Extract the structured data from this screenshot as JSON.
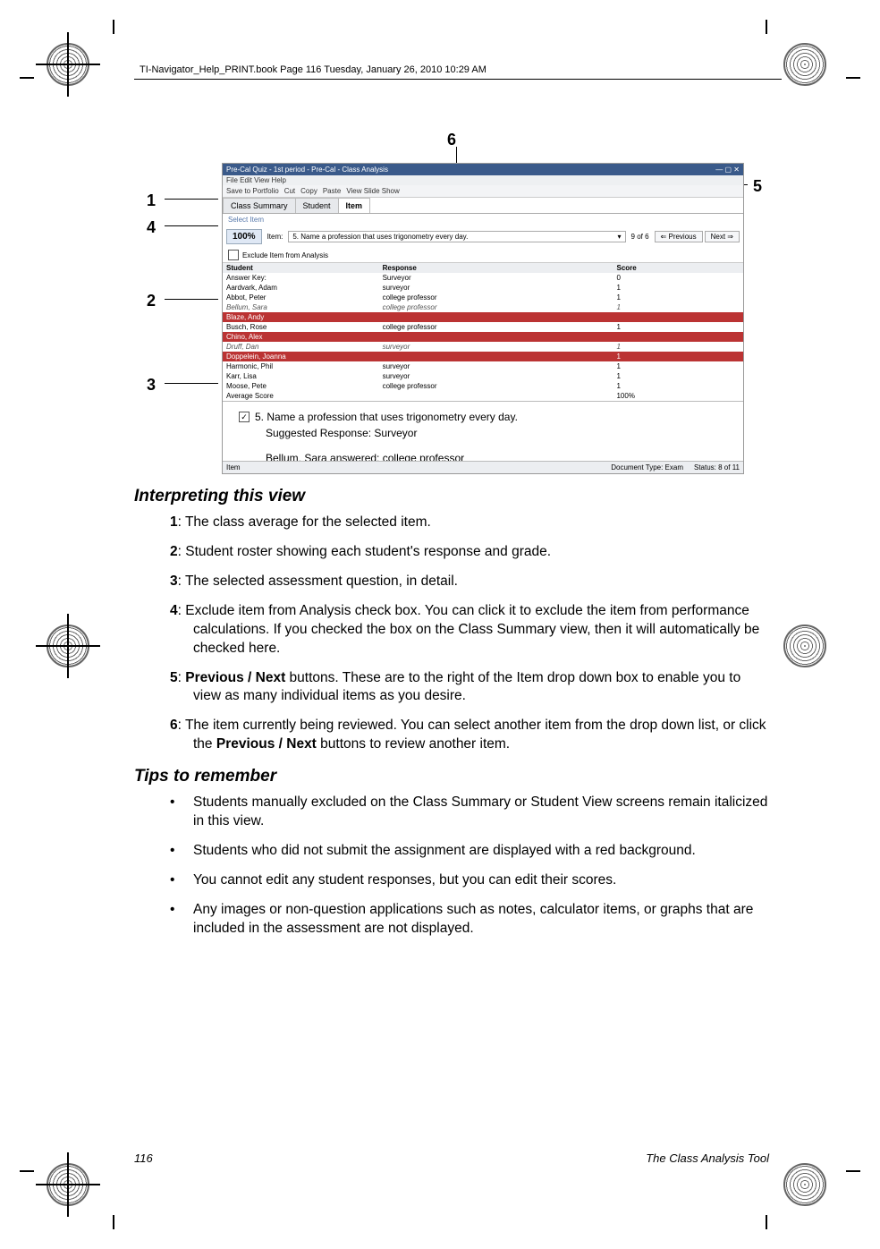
{
  "runhead": "TI-Navigator_Help_PRINT.book  Page 116  Tuesday, January 26, 2010  10:29 AM",
  "callouts": {
    "c1": "1",
    "c2": "2",
    "c3": "3",
    "c4": "4",
    "c5": "5",
    "c6": "6"
  },
  "shot": {
    "title": "Pre-Cal Quiz - 1st period - Pre-Cal - Class Analysis",
    "menus": "File    Edit    View    Help",
    "toolbar": {
      "save": "Save to Portfolio",
      "cut": "Cut",
      "copy": "Copy",
      "paste": "Paste",
      "slide": "View Slide Show"
    },
    "tabs": {
      "t1": "Class Summary",
      "t2": "Student",
      "t3": "Item"
    },
    "select_label": "Select Item",
    "score_pct": "100%",
    "item_label": "Item:",
    "item_text": "5. Name a profession that uses trigonometry every day.",
    "n_of": "9 of 6",
    "prev": "Previous",
    "next": "Next",
    "exclude": "Exclude Item from Analysis",
    "roster": {
      "h1": "Student",
      "h2": "Response",
      "h3": "Score",
      "rows": [
        {
          "n": "Answer Key:",
          "r": "Surveyor",
          "s": "0"
        },
        {
          "n": "Aardvark, Adam",
          "r": "surveyor",
          "s": "1"
        },
        {
          "n": "Abbot, Peter",
          "r": "college professor",
          "s": "1"
        },
        {
          "n": "Bellum, Sara",
          "r": "college professor",
          "s": "1",
          "i": 1
        },
        {
          "n": "Blaze, Andy",
          "r": "",
          "s": "",
          "red": 1
        },
        {
          "n": "Busch, Rose",
          "r": "college professor",
          "s": "1"
        },
        {
          "n": "Chino, Alex",
          "r": "",
          "s": "",
          "red": 1
        },
        {
          "n": "Druff, Dan",
          "r": "surveyor",
          "s": "1",
          "i": 1
        },
        {
          "n": "Doppelein, Joanna",
          "r": "",
          "s": "1",
          "red": 1
        },
        {
          "n": "Harmonic, Phil",
          "r": "surveyor",
          "s": "1"
        },
        {
          "n": "Karr, Lisa",
          "r": "surveyor",
          "s": "1"
        },
        {
          "n": "Moose, Pete",
          "r": "college professor",
          "s": "1"
        },
        {
          "n": "Average Score",
          "r": "",
          "s": "100%"
        }
      ]
    },
    "detail": {
      "q": "5. Name a profession that uses trigonometry every day.",
      "sug": "Suggested Response: Surveyor",
      "ans": "Bellum, Sara answered:  college professor"
    },
    "status": {
      "item": "Item",
      "doc": "Document Type: Exam",
      "stat": "Status: 8 of 11"
    }
  },
  "h_interpret": "Interpreting this view",
  "li1a": "1",
  "li1b": ": The class average for the selected item.",
  "li2a": "2",
  "li2b": ": Student roster showing each student's response and grade.",
  "li3a": "3",
  "li3b": ": The selected assessment question, in detail.",
  "li4a": "4",
  "li4b": ": Exclude item from Analysis check box. You can click it to exclude the item from performance calculations. If you checked the box on the Class Summary view, then it will automatically be checked here.",
  "li5a": "5",
  "li5pre": ": ",
  "li5b1": "Previous / Next",
  "li5b2": " buttons. These are to the right of the Item drop down box to enable you to view as many individual items as you desire.",
  "li6a": "6",
  "li6pre": ": The item currently being reviewed. You can select another item from the drop down list, or click the ",
  "li6b1": "Previous / Next",
  "li6b2": " buttons to review another item.",
  "h_tips": "Tips to remember",
  "b1": "Students manually excluded on the Class Summary or Student View screens remain italicized in this view.",
  "b2": "Students who did not submit the assignment are displayed with a red background.",
  "b3": "You cannot edit any student responses, but you can edit their scores.",
  "b4": "Any images or non-question applications such as notes, calculator items, or graphs that are included in the assessment are not displayed.",
  "footer": {
    "page": "116",
    "title": "The Class Analysis Tool"
  }
}
